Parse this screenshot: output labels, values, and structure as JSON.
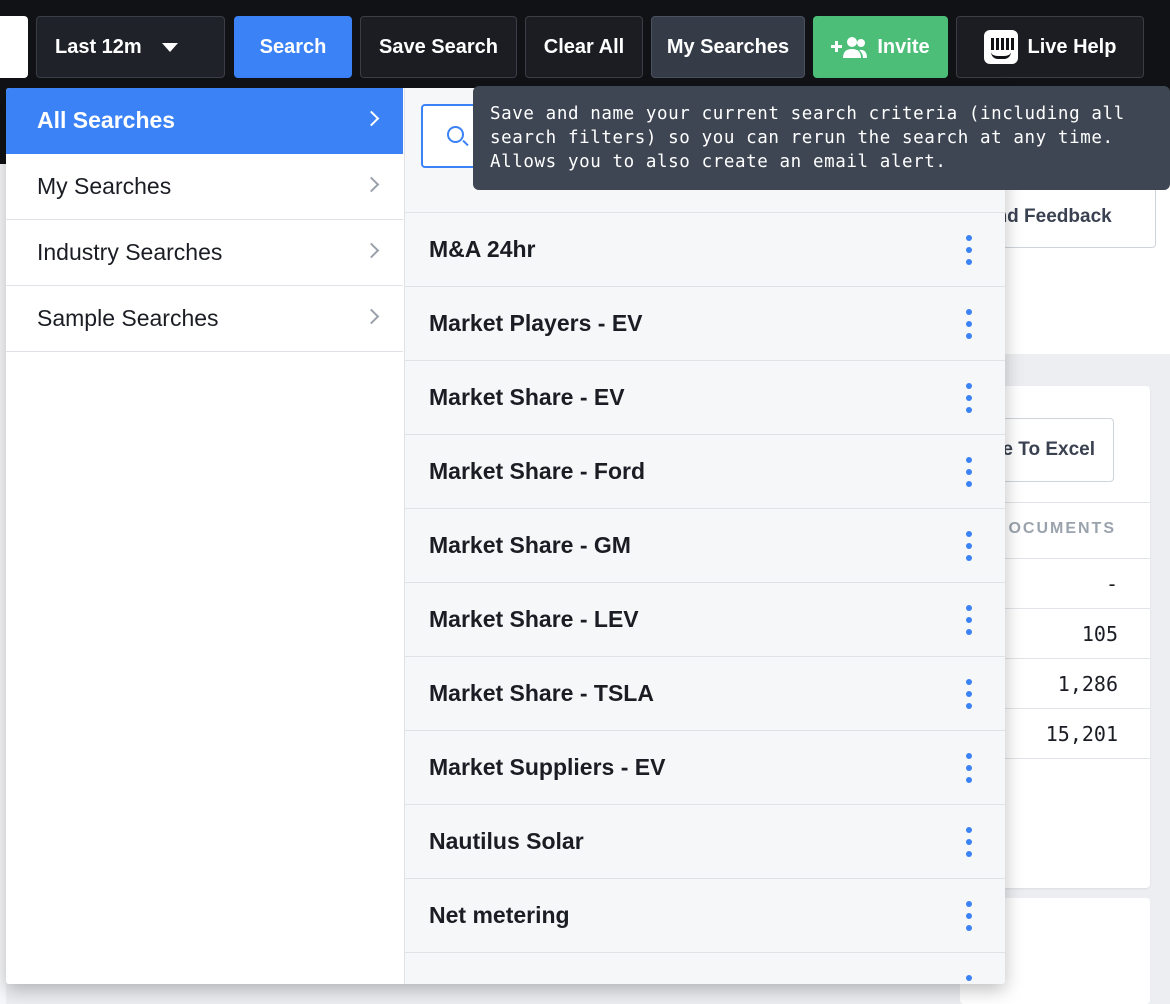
{
  "toolbar": {
    "range_label": "Last 12m",
    "search_label": "Search",
    "save_search_label": "Save Search",
    "clear_all_label": "Clear All",
    "my_searches_label": "My Searches",
    "invite_label": "Invite",
    "live_help_label": "Live Help",
    "accent_blue": "#3b82f6",
    "invite_green": "#4cbe78"
  },
  "tooltip": {
    "text": "Save and name your current search criteria (including all search filters) so you can rerun the search at any time. Allows you to also create an email alert."
  },
  "background": {
    "feedback_label": "end Feedback",
    "excel_label": "e To Excel",
    "column_header": "OCUMENTS",
    "values": [
      "-",
      "105",
      "1,286",
      "15,201"
    ]
  },
  "menu": {
    "categories": [
      {
        "label": "All Searches",
        "active": true
      },
      {
        "label": "My Searches",
        "active": false
      },
      {
        "label": "Industry Searches",
        "active": false
      },
      {
        "label": "Sample Searches",
        "active": false
      }
    ],
    "search_placeholder": "",
    "items": [
      {
        "label": "M&A 24hr"
      },
      {
        "label": "Market Players - EV"
      },
      {
        "label": "Market Share - EV"
      },
      {
        "label": "Market Share - Ford"
      },
      {
        "label": "Market Share - GM"
      },
      {
        "label": "Market Share - LEV"
      },
      {
        "label": "Market Share - TSLA"
      },
      {
        "label": "Market Suppliers - EV"
      },
      {
        "label": "Nautilus Solar"
      },
      {
        "label": "Net metering"
      }
    ]
  }
}
